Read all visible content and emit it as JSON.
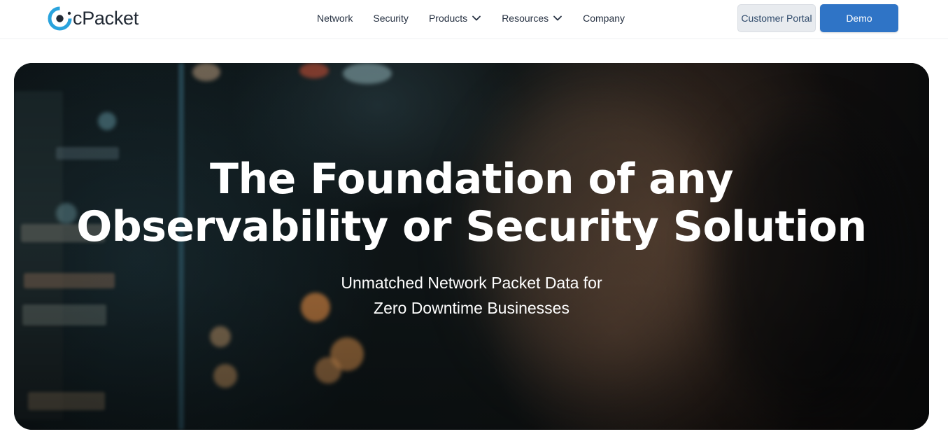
{
  "header": {
    "logo_text": "cPacket",
    "nav": [
      {
        "label": "Network",
        "has_dropdown": false
      },
      {
        "label": "Security",
        "has_dropdown": false
      },
      {
        "label": "Products",
        "has_dropdown": true
      },
      {
        "label": "Resources",
        "has_dropdown": true
      },
      {
        "label": "Company",
        "has_dropdown": false
      }
    ],
    "portal_label": "Customer Portal",
    "demo_label": "Demo"
  },
  "hero": {
    "title_line1": "The Foundation of any",
    "title_line2": "Observability or Security Solution",
    "subtitle_line1": "Unmatched Network Packet Data for",
    "subtitle_line2": "Zero Downtime Businesses"
  },
  "colors": {
    "brand_blue": "#2f74c6",
    "logo_ring": "#29a3dd",
    "text_dark": "#253041",
    "portal_bg": "#e8ebef"
  }
}
